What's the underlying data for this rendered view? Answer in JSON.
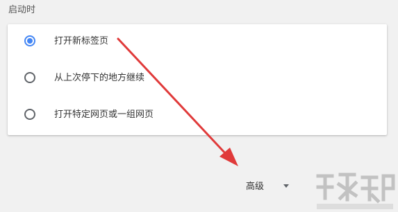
{
  "section": {
    "title": "启动时"
  },
  "startup_options": [
    {
      "label": "打开新标签页",
      "selected": true
    },
    {
      "label": "从上次停下的地方继续",
      "selected": false
    },
    {
      "label": "打开特定网页或一组网页",
      "selected": false
    }
  ],
  "advanced": {
    "label": "高级"
  },
  "colors": {
    "accent": "#4285f4",
    "annotation_arrow": "#e03a3a"
  }
}
